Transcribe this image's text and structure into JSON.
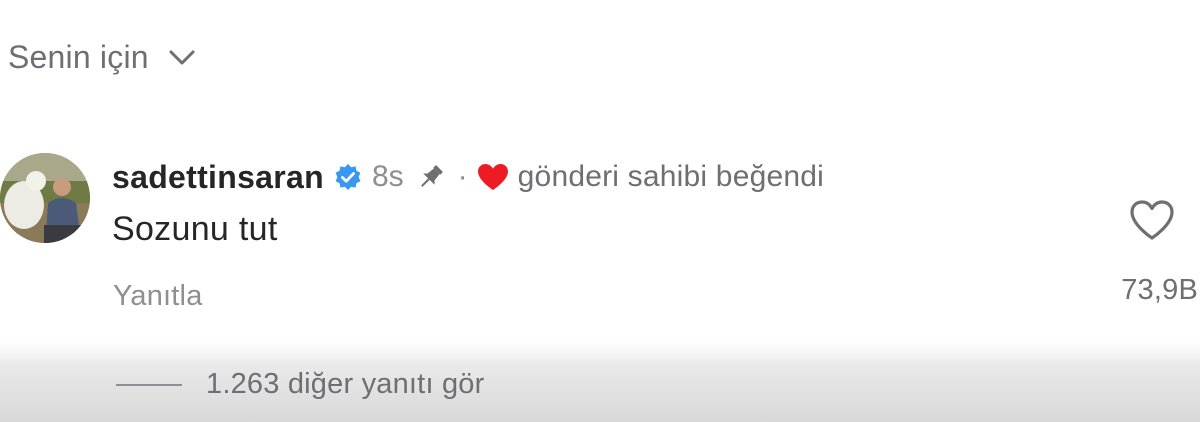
{
  "sort": {
    "label": "Senin için"
  },
  "comment": {
    "username": "sadettinsaran",
    "time": "8s",
    "separator": "·",
    "liked_by_author": "gönderi sahibi beğendi",
    "text": "Sozunu tut",
    "reply_label": "Yanıtla",
    "like_count": "73,9B",
    "icons": [
      "verified-badge-icon",
      "pin-icon",
      "heart-filled-icon",
      "heart-outline-icon"
    ]
  },
  "replies": {
    "label": "1.263 diğer yanıtı gör"
  },
  "colors": {
    "verified": "#3897f0",
    "liked_heart": "#ed1b24",
    "muted_text": "#8e8e93",
    "primary_text": "#262626"
  }
}
